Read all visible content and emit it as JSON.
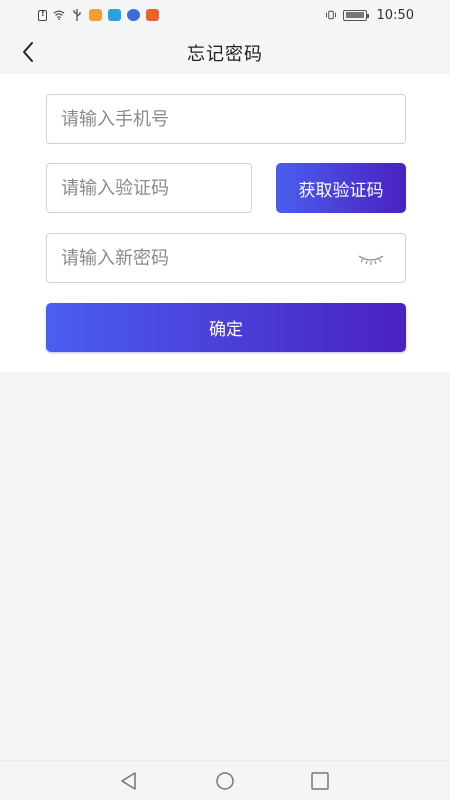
{
  "status_bar": {
    "time": "10:50",
    "icons": [
      "sim-alert-icon",
      "wifi-icon",
      "usb-icon",
      "app-icon-1",
      "app-icon-2",
      "app-icon-3",
      "app-icon-4",
      "vibrate-icon",
      "battery-icon"
    ],
    "app_colors": [
      "#f0a030",
      "#2aa0e0",
      "#3a6fd8",
      "#e8622a"
    ]
  },
  "nav": {
    "title": "忘记密码",
    "back_icon": "chevron-left-icon"
  },
  "form": {
    "phone_placeholder": "请输入手机号",
    "code_placeholder": "请输入验证码",
    "password_placeholder": "请输入新密码",
    "get_code_label": "获取验证码",
    "confirm_label": "确定",
    "eye_icon": "eye-closed-icon"
  },
  "system_nav": {
    "icons": [
      "back-triangle-icon",
      "home-circle-icon",
      "recent-square-icon"
    ]
  },
  "colors": {
    "accent_start": "#4a5ef0",
    "accent_end": "#4a21c0",
    "background": "#f4f5f7",
    "card": "#ffffff"
  }
}
